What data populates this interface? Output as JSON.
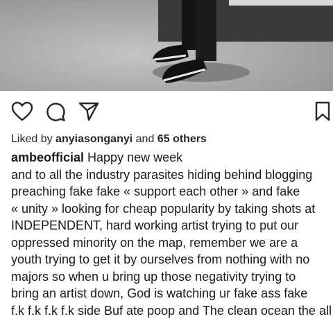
{
  "post": {
    "photo_icon": "photo-image",
    "actions": {
      "like_icon": "heart-icon",
      "comment_icon": "comment-icon",
      "share_icon": "share-icon",
      "save_icon": "bookmark-icon"
    },
    "likes": {
      "prefix": "Liked by ",
      "user": "anyiasonganyi",
      "middle": " and ",
      "others": "65 others"
    },
    "caption": {
      "username": "ambeofficial",
      "first_line": " Happy new week",
      "lines": [
        "and to all the industry parasites hiding behind blogging",
        "preaching fake fake « support each other » and fake",
        "« unity » looking for cheap popularity by taking shots at",
        "INDEPENDENT, hard working artist trying to put our",
        "oppressed minority on the map, remember we are a",
        "youth trying to get it by ourselves from nothing with no",
        "majors so when u bring up those negativity trying to",
        "bring an artist down, God is watching ur fake ass fake",
        "f.k f.k f.k f.k side Buf ate poop and The clean ocean the all"
      ]
    }
  }
}
